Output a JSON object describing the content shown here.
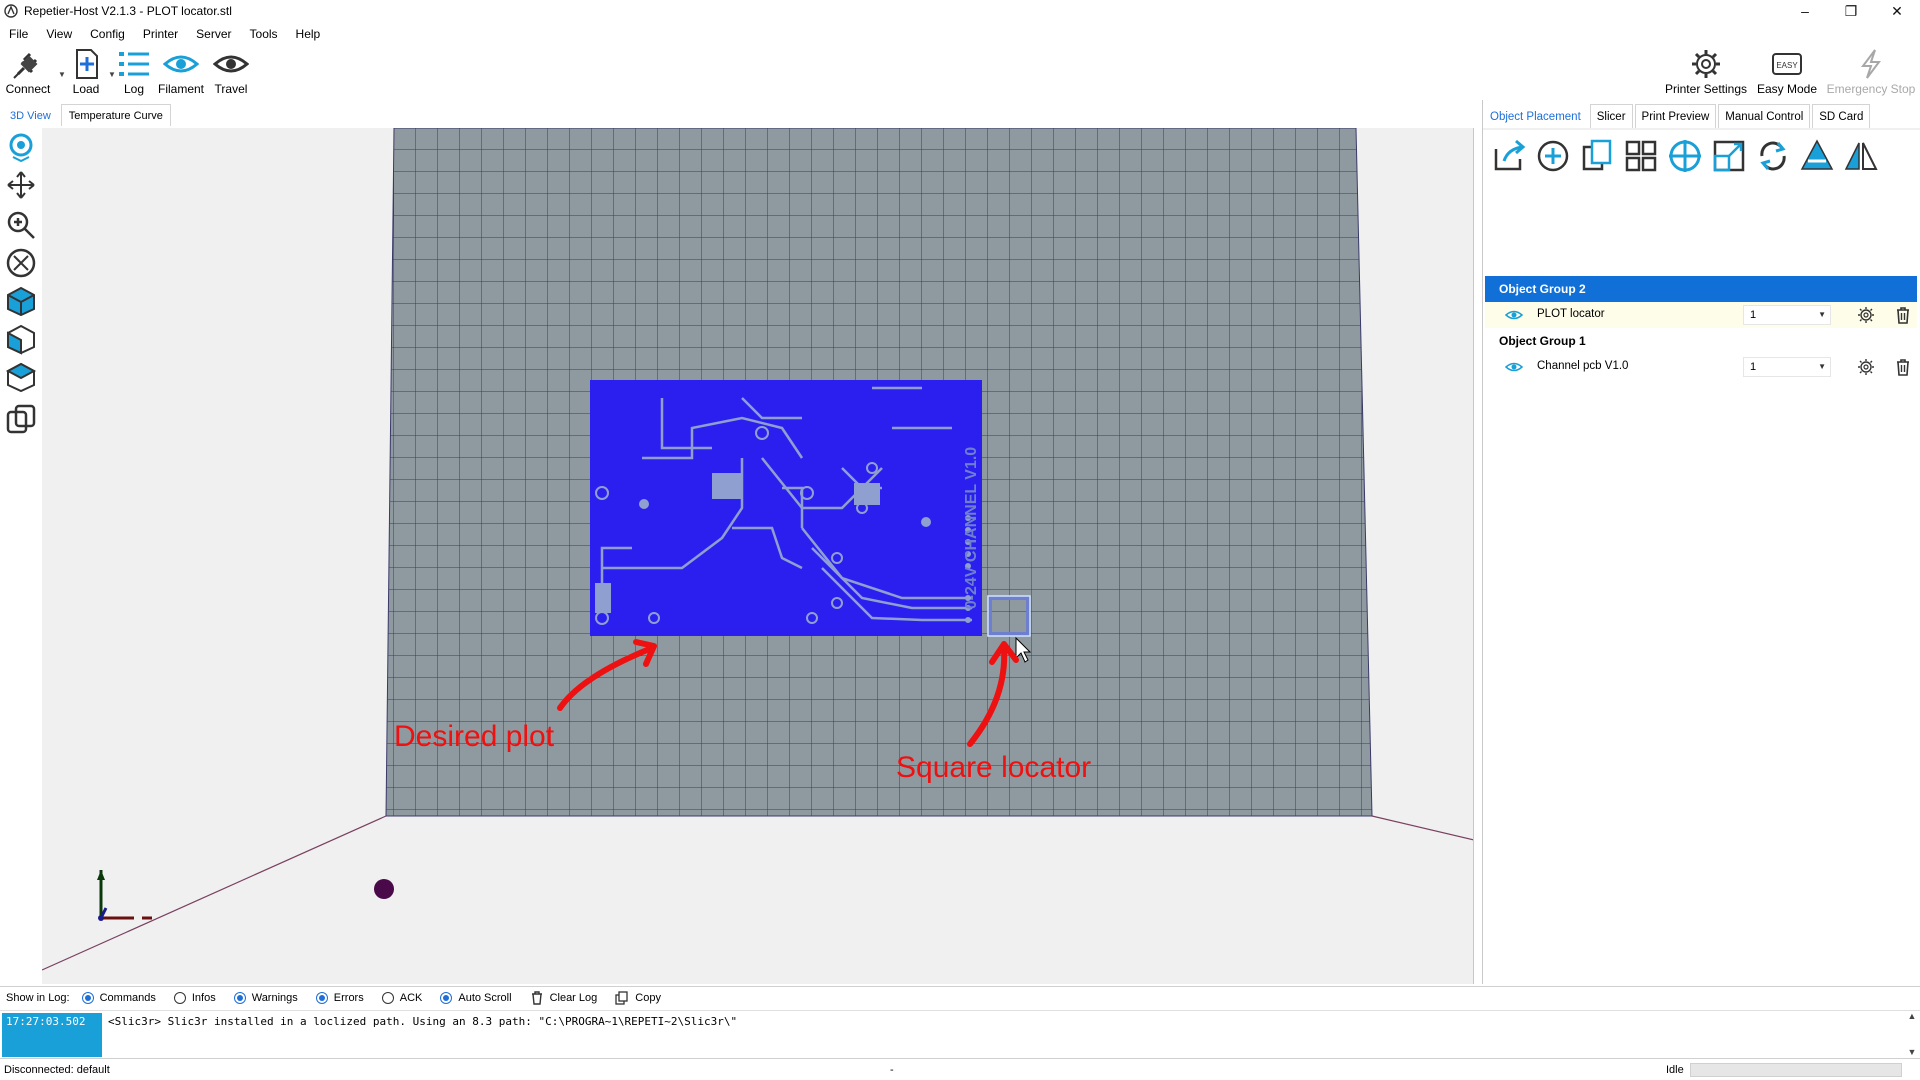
{
  "window": {
    "title": "Repetier-Host V2.1.3 - PLOT locator.stl",
    "minimize": "–",
    "maximize": "❐",
    "close": "✕"
  },
  "menu": [
    "File",
    "View",
    "Config",
    "Printer",
    "Server",
    "Tools",
    "Help"
  ],
  "toolbar": {
    "connect": "Connect",
    "load": "Load",
    "log": "Log",
    "filament": "Filament",
    "travel": "Travel",
    "printer_settings": "Printer Settings",
    "easy_mode": "Easy Mode",
    "easy_badge": "EASY",
    "emergency_stop": "Emergency Stop"
  },
  "view_tabs": [
    "3D View",
    "Temperature Curve"
  ],
  "right_tabs": [
    "Object Placement",
    "Slicer",
    "Print Preview",
    "Manual Control",
    "SD Card"
  ],
  "viewport": {
    "pcb_label": "0-24V CHANNEL V1.0",
    "annotation_left": "Desired plot",
    "annotation_right": "Square locator"
  },
  "objects": {
    "groups": [
      {
        "name": "Object Group 2",
        "item": "PLOT locator",
        "count": "1"
      },
      {
        "name": "Object Group 1",
        "item": "Channel pcb V1.0",
        "count": "1"
      }
    ]
  },
  "log": {
    "show_label": "Show in Log:",
    "options": [
      {
        "label": "Commands",
        "on": true
      },
      {
        "label": "Infos",
        "on": false
      },
      {
        "label": "Warnings",
        "on": true
      },
      {
        "label": "Errors",
        "on": true
      },
      {
        "label": "ACK",
        "on": false
      },
      {
        "label": "Auto Scroll",
        "on": true
      }
    ],
    "clear_log": "Clear Log",
    "copy": "Copy",
    "time": "17:27:03.502",
    "message": "<Slic3r> Slic3r installed in a loclized path. Using an 8.3 path: \"C:\\PROGRA~1\\REPETI~2\\Slic3r\\\""
  },
  "status": {
    "left": "Disconnected: default",
    "mid": "-",
    "right": "Idle"
  },
  "colors": {
    "accent": "#1e6fd9",
    "pcb": "#2b1ff0",
    "grid_plate": "#8f9aa0",
    "annotation": "#ee1111",
    "selection": "#1070d8"
  }
}
